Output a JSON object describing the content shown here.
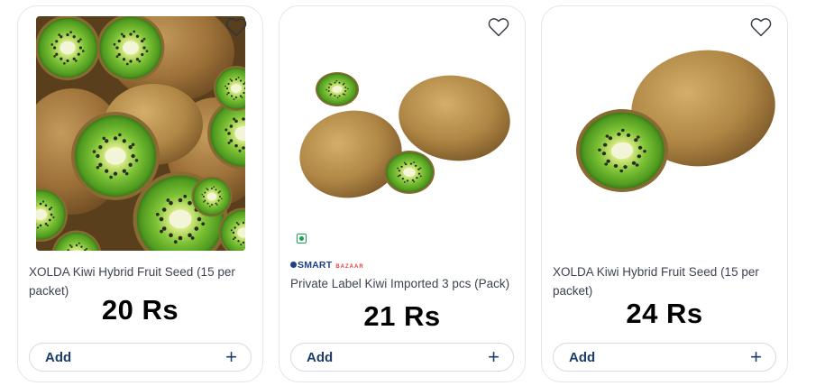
{
  "products": [
    {
      "title": "XOLDA Kiwi Hybrid Fruit Seed (15 per packet)",
      "price": "20 Rs",
      "add_label": "Add",
      "image": "kiwi-pile-image"
    },
    {
      "title": "Private Label Kiwi Imported 3 pcs (Pack)",
      "price": "21 Rs",
      "add_label": "Add",
      "brand": "SMART",
      "brand_sub": "BAZAAR",
      "image": "three-kiwis-image"
    },
    {
      "title": "XOLDA Kiwi Hybrid Fruit Seed (15 per packet)",
      "price": "24 Rs",
      "add_label": "Add",
      "image": "two-kiwis-image"
    }
  ],
  "icons": {
    "wishlist": "heart-outline-icon",
    "add": "plus-icon",
    "veg": "veg-mark-icon"
  },
  "colors": {
    "accent": "#1c3d6b",
    "kiwi_green": "#7cc23a",
    "kiwi_skin": "#9a6f3a"
  }
}
